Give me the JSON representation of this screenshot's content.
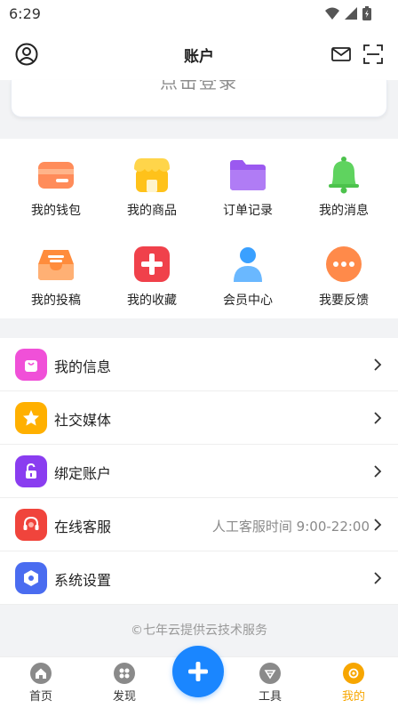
{
  "status": {
    "time": "6:29"
  },
  "header": {
    "title": "账户"
  },
  "login": {
    "text": "点击登录"
  },
  "grid": [
    {
      "label": "我的钱包",
      "icon": "wallet-icon",
      "color": "#ff8c5a"
    },
    {
      "label": "我的商品",
      "icon": "shop-icon",
      "color": "#ffc21a"
    },
    {
      "label": "订单记录",
      "icon": "folder-icon",
      "color": "#9b59f0"
    },
    {
      "label": "我的消息",
      "icon": "bell-icon",
      "color": "#5fd35f"
    },
    {
      "label": "我的投稿",
      "icon": "inbox-icon",
      "color": "#ff8c3c"
    },
    {
      "label": "我的收藏",
      "icon": "plus-box-icon",
      "color": "#f0414b"
    },
    {
      "label": "会员中心",
      "icon": "user-icon",
      "color": "#3aa0ff"
    },
    {
      "label": "我要反馈",
      "icon": "more-icon",
      "color": "#ff8a4a"
    }
  ],
  "list": [
    {
      "label": "我的信息",
      "icon": "bag-icon",
      "color": "#f050d8",
      "note": ""
    },
    {
      "label": "社交媒体",
      "icon": "star-icon",
      "color": "#ffb000",
      "note": ""
    },
    {
      "label": "绑定账户",
      "icon": "unlock-icon",
      "color": "#8a3df0",
      "note": ""
    },
    {
      "label": "在线客服",
      "icon": "headset-icon",
      "color": "#f0443c",
      "note": "人工客服时间 9:00-22:00"
    },
    {
      "label": "系统设置",
      "icon": "settings-icon",
      "color": "#4a6cf0",
      "note": ""
    }
  ],
  "footer": {
    "note": "©七年云提供云技术服务"
  },
  "tabbar": [
    {
      "label": "首页",
      "icon": "home-icon",
      "active": false
    },
    {
      "label": "发现",
      "icon": "discover-icon",
      "active": false
    },
    {
      "label": "工具",
      "icon": "tools-icon",
      "active": false
    },
    {
      "label": "我的",
      "icon": "me-icon",
      "active": true
    }
  ],
  "colors": {
    "accent": "#1a86ff",
    "active_tab": "#f7a600"
  }
}
